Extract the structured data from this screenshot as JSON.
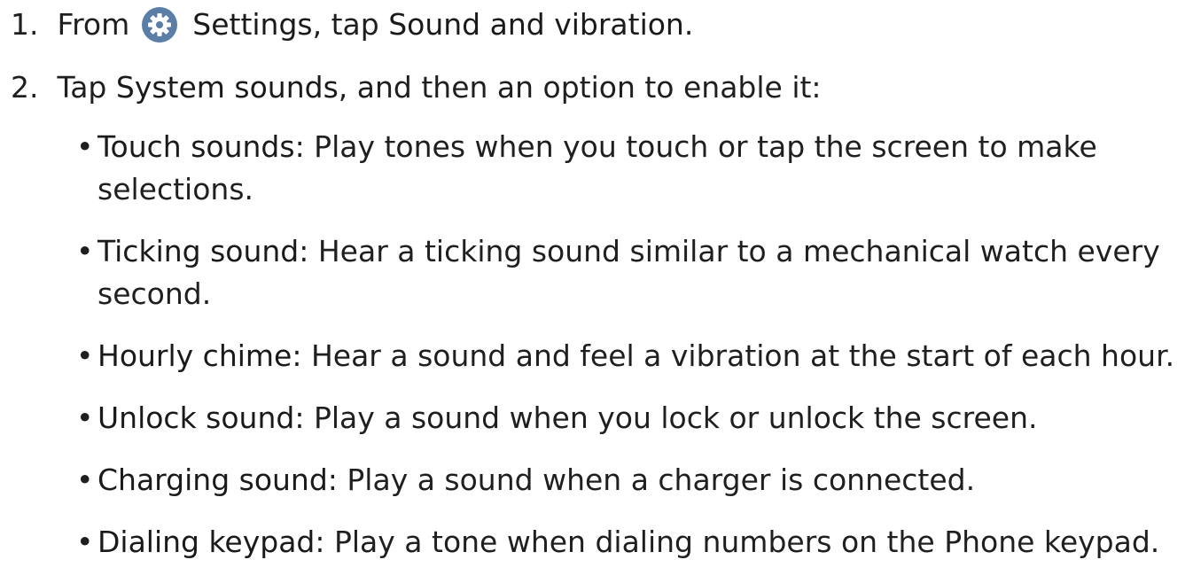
{
  "steps": [
    {
      "number": "1.",
      "pre": "From",
      "icon": "settings-gear-icon",
      "term": "Settings",
      "mid": ", tap",
      "term2": "Sound and vibration",
      "post": "."
    },
    {
      "number": "2.",
      "pre": "Tap",
      "term": "System sounds",
      "post": ", and then an option to enable it:"
    }
  ],
  "options": [
    {
      "term": "Touch sounds",
      "desc": ": Play tones when you touch or tap the screen to make selections."
    },
    {
      "term": "Ticking sound",
      "desc": ": Hear a ticking sound similar to a mechanical watch every second."
    },
    {
      "term": "Hourly chime",
      "desc": ": Hear a sound and feel a vibration at the start of each hour."
    },
    {
      "term": "Unlock sound",
      "desc": ": Play a sound when you lock or unlock the screen."
    },
    {
      "term": "Charging sound",
      "desc": ": Play a sound when a charger is connected."
    },
    {
      "term": "Dialing keypad",
      "desc": ": Play a tone when dialing numbers on the Phone keypad."
    }
  ],
  "colors": {
    "gear_icon_bg": "#5b7da6",
    "text": "#1f1f1f"
  }
}
